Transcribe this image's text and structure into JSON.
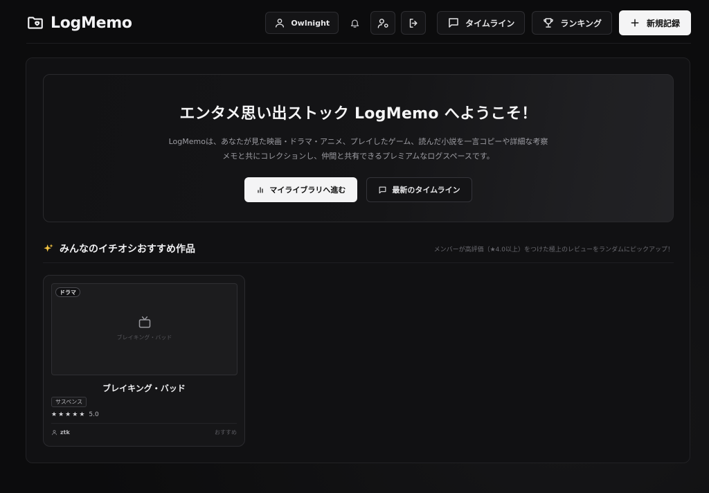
{
  "header": {
    "logo_text": "LogMemo",
    "user_label": "Owlnight",
    "timeline_label": "タイムライン",
    "ranking_label": "ランキング",
    "new_record_label": "新規記録"
  },
  "hero": {
    "title": "エンタメ思い出ストック LogMemo へようこそ！",
    "desc_line1": "LogMemoは、あなたが見た映画・ドラマ・アニメ、プレイしたゲーム、読んだ小説を一言コピーや詳細な考察",
    "desc_line2": "メモと共にコレクションし、仲間と共有できるプレミアムなログスペースです。",
    "library_button": "マイライブラリへ進む",
    "timeline_button": "最新のタイムライン"
  },
  "section": {
    "title": "みんなのイチオシおすすめ作品",
    "note": "メンバーが高評価（★4.0以上）をつけた極上のレビューをランダムにピックアップ！"
  },
  "card": {
    "genre": "ドラマ",
    "thumb_text": "ブレイキング・バッド",
    "title": "ブレイキング・バッド",
    "tag": "サスペンス",
    "rating": "5.0",
    "stars": 5,
    "user": "ztk",
    "recommend_label": "おすすめ"
  },
  "colors": {
    "background": "#0c0c0d",
    "accent_light": "#f4f4f5",
    "sparkle": "#f5c542"
  }
}
